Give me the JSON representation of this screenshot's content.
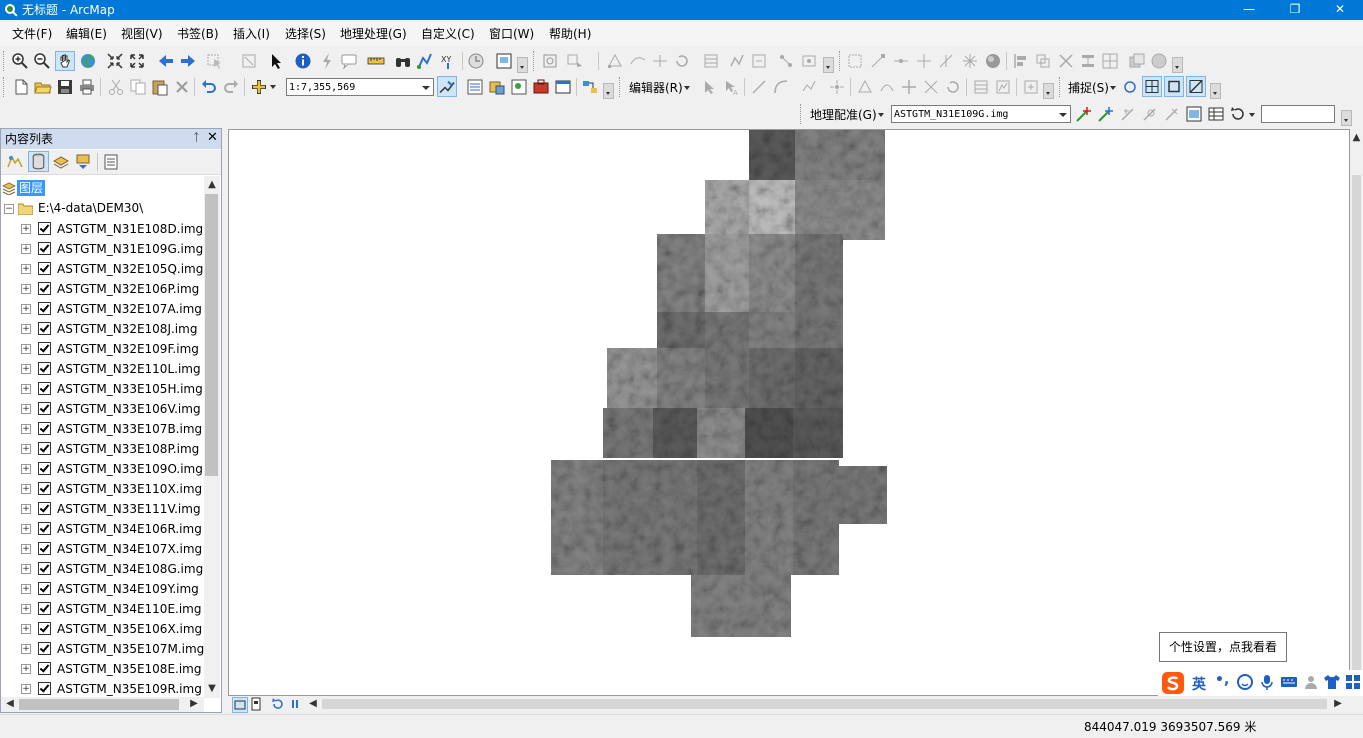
{
  "window": {
    "title": "无标题 - ArcMap",
    "minimize": "—",
    "maximize": "❐",
    "close": "✕"
  },
  "menubar": {
    "items": [
      "文件(F)",
      "编辑(E)",
      "视图(V)",
      "书签(B)",
      "插入(I)",
      "选择(S)",
      "地理处理(G)",
      "自定义(C)",
      "窗口(W)",
      "帮助(H)"
    ]
  },
  "toolbar2": {
    "scale": "1:7,355,569",
    "editor_label": "编辑器(R)",
    "snapping_label": "捕捉(S)"
  },
  "toolbar3": {
    "georef_label": "地理配准(G)",
    "layer_combo": "ASTGTM_N31E109G.img",
    "input_value": ""
  },
  "toc": {
    "title": "内容列表",
    "pin": "ᛏ",
    "close": "✕",
    "root_label": "图层",
    "folder_label": "E:\\4-data\\DEM30\\",
    "layers": [
      "ASTGTM_N31E108D.img",
      "ASTGTM_N31E109G.img",
      "ASTGTM_N32E105Q.img",
      "ASTGTM_N32E106P.img",
      "ASTGTM_N32E107A.img",
      "ASTGTM_N32E108J.img",
      "ASTGTM_N32E109F.img",
      "ASTGTM_N32E110L.img",
      "ASTGTM_N33E105H.img",
      "ASTGTM_N33E106V.img",
      "ASTGTM_N33E107B.img",
      "ASTGTM_N33E108P.img",
      "ASTGTM_N33E109O.img",
      "ASTGTM_N33E110X.img",
      "ASTGTM_N33E111V.img",
      "ASTGTM_N34E106R.img",
      "ASTGTM_N34E107X.img",
      "ASTGTM_N34E108G.img",
      "ASTGTM_N34E109Y.img",
      "ASTGTM_N34E110E.img",
      "ASTGTM_N35E106X.img",
      "ASTGTM_N35E107M.img",
      "ASTGTM_N35E108E.img",
      "ASTGTM_N35E109R.img"
    ]
  },
  "status": {
    "coordinates": "844047.019  3693507.569 米"
  },
  "ime": {
    "tooltip": "个性设置，点我看看",
    "lang": "英",
    "punct": "•,"
  },
  "colors": {
    "titlebar": "#0078d7",
    "panel_header": "#cfdcef",
    "selection": "#3399ff"
  }
}
